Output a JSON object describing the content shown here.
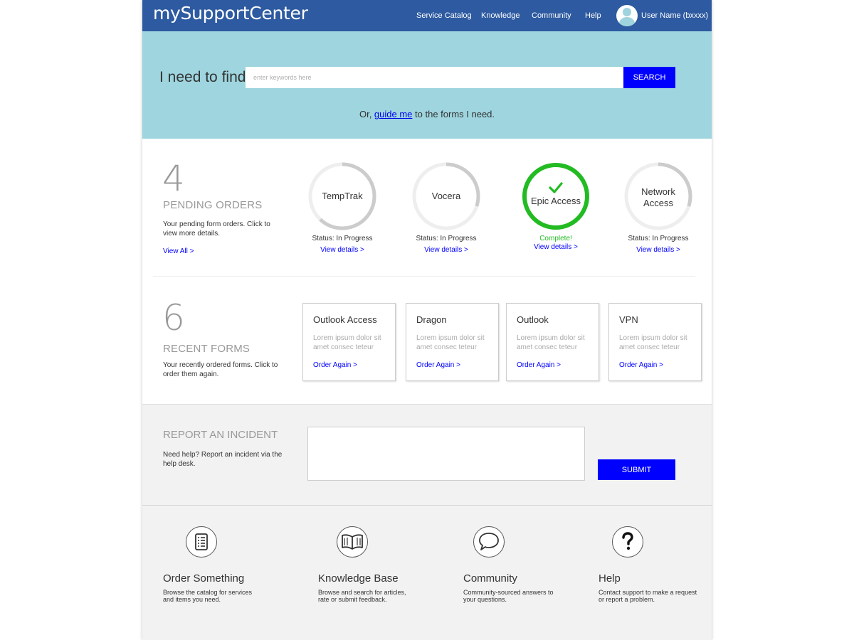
{
  "header": {
    "brand": "mySupportCenter",
    "nav": [
      "Service Catalog",
      "Knowledge",
      "Community",
      "Help"
    ],
    "user_name": "User Name (bxxxx)"
  },
  "hero": {
    "title": "I need to find",
    "search_placeholder": "enter keywords here",
    "search_button": "SEARCH",
    "guide_prefix": "Or, ",
    "guide_link": "guide me",
    "guide_suffix": " to the forms I need."
  },
  "pending": {
    "count": "4",
    "title": "PENDING ORDERS",
    "description": "Your pending form orders.  Click to view more details.",
    "view_all": "View All  >",
    "orders": [
      {
        "name_lines": [
          "TempTrak"
        ],
        "status": "Status: In Progress",
        "link": "View details >",
        "progress": 0.62,
        "complete": false
      },
      {
        "name_lines": [
          "Vocera"
        ],
        "status": "Status: In Progress",
        "link": "View details >",
        "progress": 0.3,
        "complete": false
      },
      {
        "name_lines": [
          "Epic Access"
        ],
        "status": "Complete!",
        "link": "View details >",
        "progress": 1.0,
        "complete": true
      },
      {
        "name_lines": [
          "Network",
          "Access"
        ],
        "status": "Status: In Progress",
        "link": "View details >",
        "progress": 0.3,
        "complete": false
      }
    ]
  },
  "recent": {
    "count": "6",
    "title": "RECENT FORMS",
    "description": "Your recently ordered forms.  Click to order them again.",
    "forms": [
      {
        "title": "Outlook Access",
        "desc": "Lorem ipsum dolor sit amet consec teteur",
        "link": "Order Again >"
      },
      {
        "title": "Dragon",
        "desc": "Lorem ipsum dolor sit amet consec teteur",
        "link": "Order Again >"
      },
      {
        "title": "Outlook",
        "desc": "Lorem ipsum dolor sit amet consec teteur",
        "link": "Order Again >"
      },
      {
        "title": "VPN",
        "desc": "Lorem ipsum dolor sit amet consec teteur",
        "link": "Order Again >"
      }
    ]
  },
  "incident": {
    "title": "REPORT AN INCIDENT",
    "description": "Need help?  Report an incident via the help desk.",
    "submit": "SUBMIT"
  },
  "footer": {
    "items": [
      {
        "icon": "clipboard-list-icon",
        "title": "Order Something",
        "desc": "Browse the catalog for services and items you need."
      },
      {
        "icon": "open-book-icon",
        "title": "Knowledge Base",
        "desc": "Browse and search for articles, rate or submit feedback."
      },
      {
        "icon": "speech-bubble-icon",
        "title": "Community",
        "desc": "Community-sourced answers to your questions."
      },
      {
        "icon": "question-mark-icon",
        "title": "Help",
        "desc": "Contact support to make a request or report a problem."
      }
    ]
  },
  "colors": {
    "header": "#2d5aa0",
    "hero": "#9ed5df",
    "accent_button": "#0000ff",
    "link": "#0000ff",
    "ring_track": "#eeeeee",
    "ring_progress": "#cccccc",
    "complete": "#22bb22"
  }
}
